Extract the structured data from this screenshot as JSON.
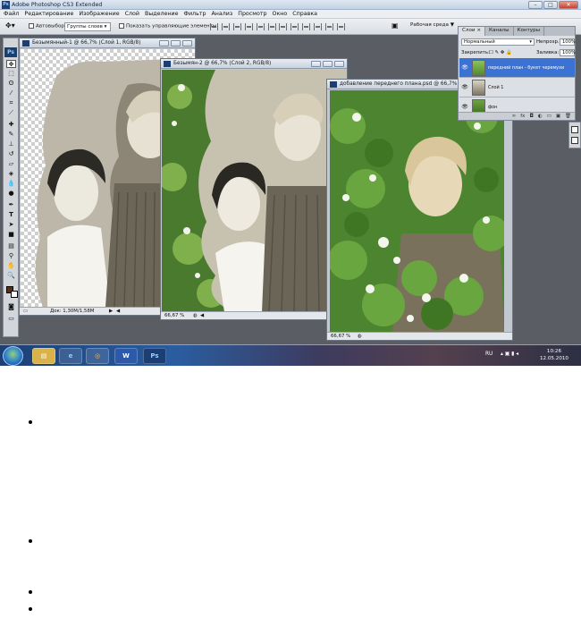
{
  "app": {
    "title": "Adobe Photoshop CS3 Extended",
    "window_controls": [
      "–",
      "□",
      "✕"
    ]
  },
  "menu": [
    "Файл",
    "Редактирование",
    "Изображение",
    "Слой",
    "Выделение",
    "Фильтр",
    "Анализ",
    "Просмотр",
    "Окно",
    "Справка"
  ],
  "options_bar": {
    "auto_select_label": "Автовыбор:",
    "auto_select_value": "Группы слоев",
    "show_controls_label": "Показать управляющие элементы",
    "workspace_label": "Рабочая среда ▼"
  },
  "documents": {
    "doc1": {
      "title": "Безымянный-1 @ 66,7% (Слой 1, RGB/8)",
      "status": "Док: 1,30М/1,58М"
    },
    "doc2": {
      "title": "Безымян-2 @ 66,7% (Слой 2, RGB/8)",
      "zoom": "66,67 %"
    },
    "doc3": {
      "title": "добавление переднего плана.psd @ 66,7% (передний",
      "zoom": "66,67 %"
    }
  },
  "layers_panel": {
    "tabs": [
      "Слои ×",
      "Каналы",
      "Контуры"
    ],
    "blend_mode": "Нормальный",
    "opacity_label": "Непрозр.:",
    "opacity_value": "100%",
    "lock_label": "Закрепить:",
    "fill_label": "Заливка:",
    "fill_value": "100%",
    "layers": [
      {
        "name": "передний план - букет черемухи",
        "selected": true
      },
      {
        "name": "Слой 1",
        "selected": false
      },
      {
        "name": "фон",
        "selected": false
      }
    ],
    "footer_icons": [
      "link-icon",
      "fx-icon",
      "mask-icon",
      "adjustment-icon",
      "group-icon",
      "new-layer-icon",
      "trash-icon"
    ]
  },
  "taskbar": {
    "language": "RU",
    "time": "10:26",
    "date": "12.05.2010",
    "apps": [
      "explorer-icon",
      "ie-icon",
      "media-icon",
      "word-icon",
      "photoshop-icon"
    ],
    "ps_label": "Ps",
    "word_label": "W"
  },
  "colors": {
    "foreground": "#5a2e12",
    "background": "#ffffff",
    "selected_layer": "#3b73d4"
  }
}
